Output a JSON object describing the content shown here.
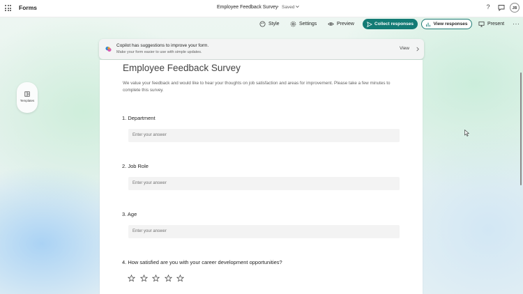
{
  "app": {
    "name": "Forms"
  },
  "header": {
    "doc_title": "Employee Feedback Survey",
    "separator": "-",
    "status": "Saved",
    "help": "?",
    "avatar_initials": "JB"
  },
  "toolbar": {
    "style": "Style",
    "settings": "Settings",
    "preview": "Preview",
    "collect": "Collect responses",
    "view_responses": "View responses",
    "present": "Present",
    "more": "···"
  },
  "copilot": {
    "title": "Copilot has suggestions to improve your form.",
    "subtitle": "Make your form easier to use with simple updates.",
    "view": "View"
  },
  "side": {
    "templates": "Templates"
  },
  "form": {
    "title": "Employee Feedback Survey",
    "description": "We value your feedback and would like to hear your thoughts on job satisfaction and areas for improvement. Please take a few minutes to complete this survey.",
    "questions": [
      {
        "label": "1. Department",
        "placeholder": "Enter your answer"
      },
      {
        "label": "2. Job Role",
        "placeholder": "Enter your answer"
      },
      {
        "label": "3. Age",
        "placeholder": "Enter your answer"
      },
      {
        "label": "4. How satisfied are you with your career development opportunities?",
        "rating": 5
      }
    ]
  },
  "colors": {
    "accent": "#137b75",
    "card": "#ffffff"
  }
}
